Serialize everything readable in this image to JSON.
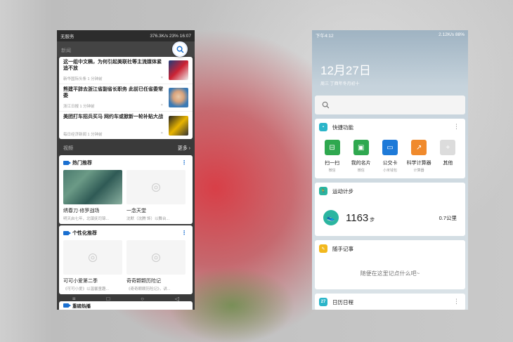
{
  "left": {
    "status": {
      "carrier": "无服务",
      "speed": "376.3K/s",
      "battery": "23%",
      "time": "16:07"
    },
    "news": {
      "header": "新闻",
      "items": [
        {
          "title": "这一组中文稿，为何引起美联社等主流媒体紧追不放",
          "source": "新华国际头条 1 分钟前"
        },
        {
          "title": "熊建平辞去浙江省副省长职务 此前已任省委常委",
          "source": "浙江日报 1 分钟前"
        },
        {
          "title": "美团打车招兵买马 网约车或掀新一轮补贴大战",
          "source": "每日经济新闻 1 分钟前"
        }
      ]
    },
    "video_section": {
      "label": "视频",
      "more": "更多"
    },
    "hot": {
      "title": "热门推荐",
      "videos": [
        {
          "title": "绣春刀·修罗战场",
          "sub": "明天启七年，北镇抚司锦..."
        },
        {
          "title": "一念天堂",
          "sub": "沈默（沈腾 饰）以舞台..."
        }
      ]
    },
    "personal": {
      "title": "个性化推荐",
      "videos": [
        {
          "title": "可可小爱第二季",
          "sub": "《可可小爱》以温馨童趣..."
        },
        {
          "title": "奇奇颗颗历险记",
          "sub": "《奇奇颗颗历险记》，讲..."
        }
      ]
    },
    "peek_title": "重磅热播"
  },
  "right": {
    "status": {
      "time": "下午4:12",
      "speed": "2.12K/s",
      "battery": "88%"
    },
    "date": {
      "big": "12月27日",
      "small": "周三 丁酉年冬月初十"
    },
    "quick": {
      "title": "快捷功能",
      "items": [
        {
          "label": "扫一扫",
          "sub": "微信",
          "color": "#2fa84f",
          "glyph": "⊟"
        },
        {
          "label": "我的名片",
          "sub": "微信",
          "color": "#2fa84f",
          "glyph": "▣"
        },
        {
          "label": "公交卡",
          "sub": "小米钱包",
          "color": "#1e7ad8",
          "glyph": "▭"
        },
        {
          "label": "科学计算器",
          "sub": "计算器",
          "color": "#f08a2c",
          "glyph": "↗"
        },
        {
          "label": "其他",
          "sub": "",
          "color": "#dcdcdc",
          "glyph": "+"
        }
      ]
    },
    "steps": {
      "title": "运动计步",
      "count": "1163",
      "unit": "步",
      "distance": "0.7公里"
    },
    "notes": {
      "title": "随手记事",
      "placeholder": "随便在这里记点什么吧~"
    },
    "calendar": {
      "title": "日历日程",
      "day": "27"
    }
  }
}
